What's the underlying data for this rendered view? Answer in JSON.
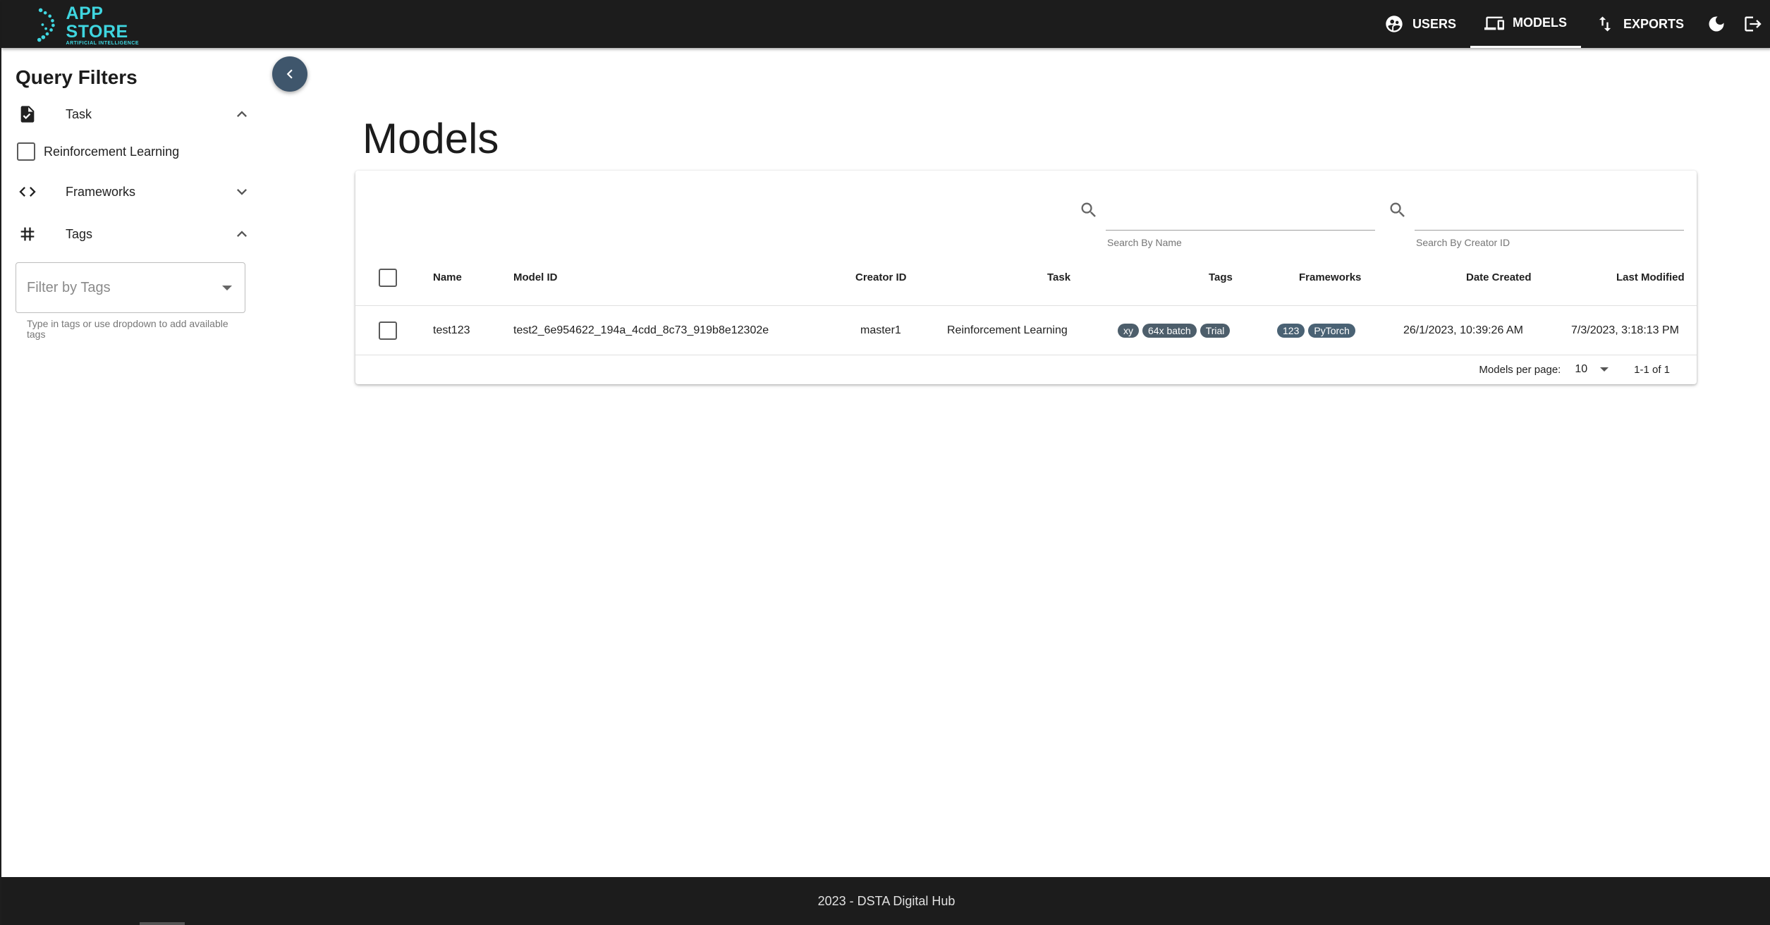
{
  "app": {
    "logo_title": "APP STORE",
    "logo_subtitle": "ARTIFICIAL INTELLIGENCE",
    "accent_color": "#3fd6e0"
  },
  "nav": {
    "users": "USERS",
    "models": "MODELS",
    "exports": "EXPORTS",
    "icons": [
      "users-icon",
      "models-icon",
      "exports-icon",
      "dark-mode-icon",
      "logout-icon"
    ]
  },
  "sidebar": {
    "title": "Query Filters",
    "task_label": "Task",
    "task_option": "Reinforcement Learning",
    "frameworks_label": "Frameworks",
    "tags_label": "Tags",
    "tags_placeholder": "Filter by Tags",
    "tags_helper": "Type in tags or use dropdown to add available tags"
  },
  "main": {
    "title": "Models",
    "search_name_label": "Search By Name",
    "search_creator_label": "Search By Creator ID",
    "columns": {
      "name": "Name",
      "model_id": "Model ID",
      "creator_id": "Creator ID",
      "task": "Task",
      "tags": "Tags",
      "frameworks": "Frameworks",
      "date_created": "Date Created",
      "last_modified": "Last Modified"
    },
    "rows": [
      {
        "name": "test123",
        "model_id": "test2_6e954622_194a_4cdd_8c73_919b8e12302e",
        "creator_id": "master1",
        "task": "Reinforcement Learning",
        "tags": [
          "xy",
          "64x batch",
          "Trial"
        ],
        "frameworks": [
          "123",
          "PyTorch"
        ],
        "date_created": "26/1/2023, 10:39:26 AM",
        "last_modified": "7/3/2023, 3:18:13 PM"
      }
    ],
    "per_page_label": "Models per page:",
    "per_page_value": "10",
    "page_info": "1-1 of 1"
  },
  "footer": {
    "text": "2023 - DSTA Digital Hub"
  }
}
